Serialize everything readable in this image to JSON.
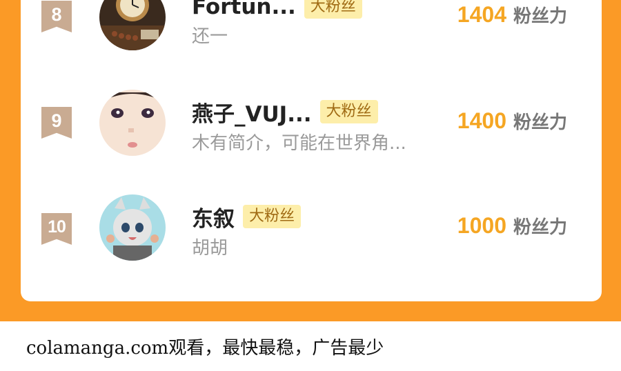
{
  "ranking": {
    "items": [
      {
        "rank": "8",
        "name": "Fortun...",
        "badge": "大粉丝",
        "bio": "还一",
        "score": "1404",
        "unit": "粉丝力",
        "avatar_icon": "clock-avatar-icon"
      },
      {
        "rank": "9",
        "name": "燕子_VUJ...",
        "badge": "大粉丝",
        "bio": "木有简介，可能在世界角...",
        "score": "1400",
        "unit": "粉丝力",
        "avatar_icon": "face-avatar-icon"
      },
      {
        "rank": "10",
        "name": "东叙",
        "badge": "大粉丝",
        "bio": "胡胡",
        "score": "1000",
        "unit": "粉丝力",
        "avatar_icon": "anime-character-avatar-icon"
      }
    ]
  },
  "footer": {
    "text": "colamanga.com观看，最快最稳，广告最少"
  },
  "colors": {
    "accent": "#fb9a26",
    "score": "#f5a623",
    "badge_bg": "#fdeeaa",
    "rank_bg": "#c9ab92"
  }
}
